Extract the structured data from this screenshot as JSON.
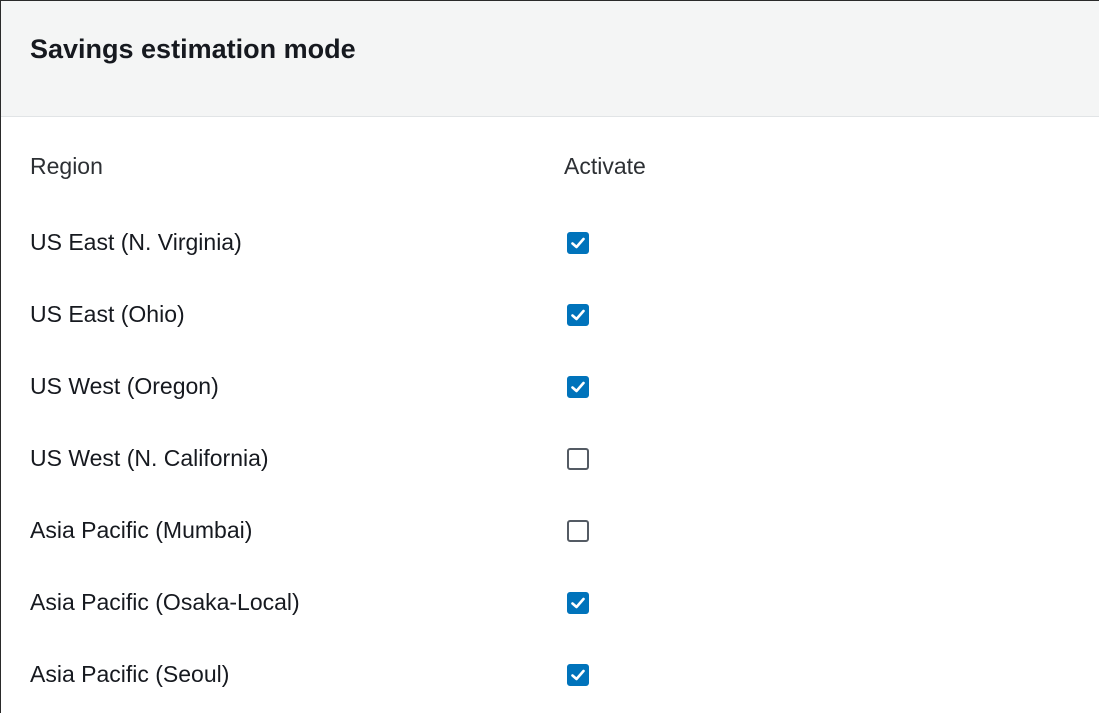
{
  "panel": {
    "title": "Savings estimation mode"
  },
  "table": {
    "headers": {
      "region": "Region",
      "activate": "Activate"
    },
    "rows": [
      {
        "region": "US East (N. Virginia)",
        "activated": true
      },
      {
        "region": "US East (Ohio)",
        "activated": true
      },
      {
        "region": "US West (Oregon)",
        "activated": true
      },
      {
        "region": "US West (N. California)",
        "activated": false
      },
      {
        "region": "Asia Pacific (Mumbai)",
        "activated": false
      },
      {
        "region": "Asia Pacific (Osaka-Local)",
        "activated": true
      },
      {
        "region": "Asia Pacific (Seoul)",
        "activated": true
      }
    ]
  },
  "colors": {
    "checkbox_checked": "#0073bb",
    "checkbox_unchecked_border": "#545b64",
    "header_bg": "#f4f5f5"
  },
  "icons": {
    "checked": "checkmark-icon"
  }
}
